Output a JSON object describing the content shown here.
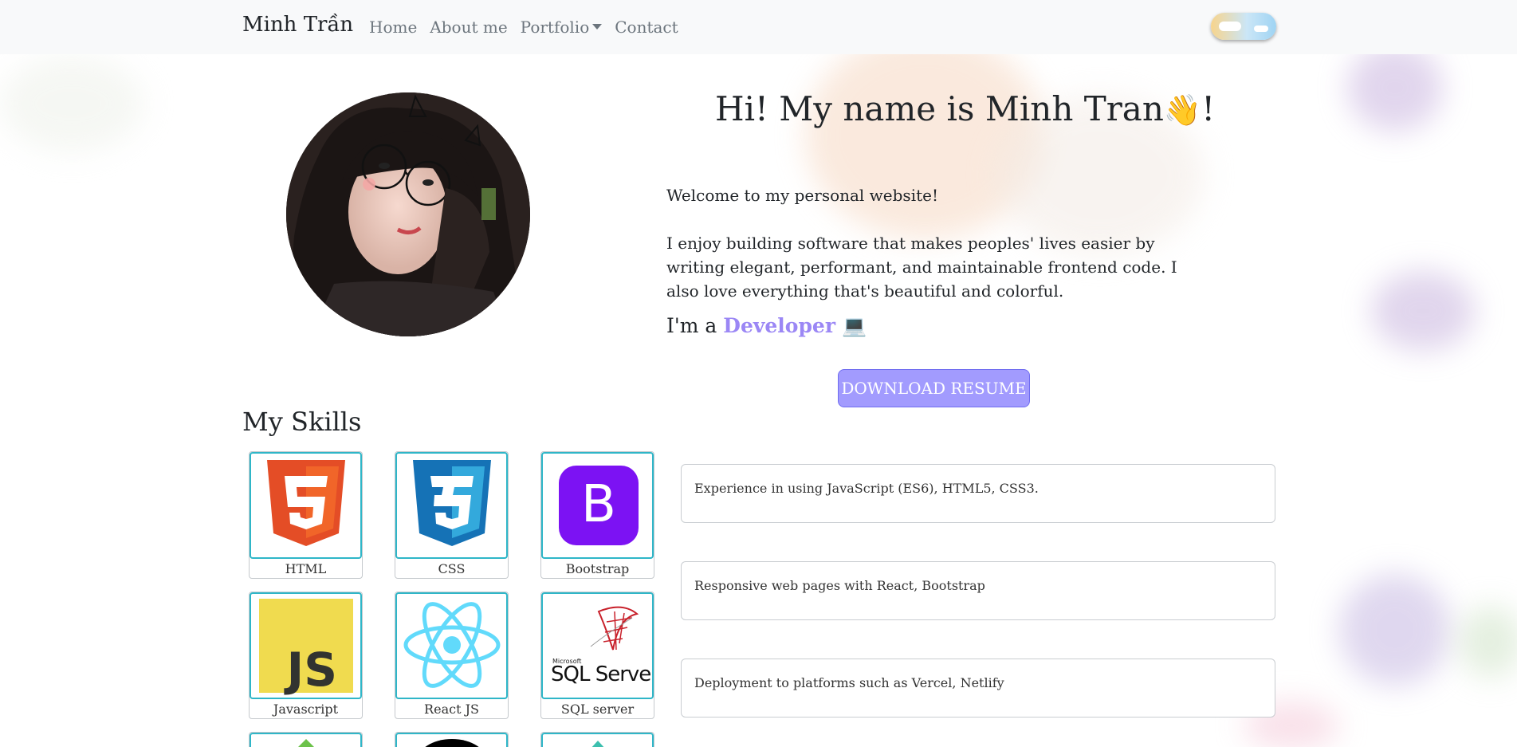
{
  "nav": {
    "brand": "Minh Trần",
    "links": [
      "Home",
      "About me",
      "Portfolio",
      "Contact"
    ]
  },
  "hero": {
    "title": "Hi! My name is Minh Tran",
    "title_suffix": "!",
    "wave_emoji": "👋",
    "welcome": "Welcome to my personal website!",
    "bio": "I enjoy building software that makes peoples' lives easier by writing elegant, performant, and maintainable frontend code. I also love everything that's beautiful and colorful.",
    "role_prefix": "I'm a",
    "role_highlight": "Developer",
    "role_emoji": "💻",
    "resume_button": "DOWNLOAD RESUME"
  },
  "skills": {
    "title": "My Skills",
    "items": [
      {
        "label": "HTML",
        "icon": "html5-icon"
      },
      {
        "label": "CSS",
        "icon": "css3-icon"
      },
      {
        "label": "Bootstrap",
        "icon": "bootstrap-icon"
      },
      {
        "label": "Javascript",
        "icon": "javascript-icon"
      },
      {
        "label": "React JS",
        "icon": "react-icon"
      },
      {
        "label": "SQL server",
        "icon": "sql-server-icon"
      }
    ],
    "sql_logo_small": "Microsoft",
    "sql_logo_text": "SQL Server",
    "experience": [
      "Experience in using JavaScript (ES6), HTML5, CSS3.",
      "Responsive web pages with React, Bootstrap",
      "Deployment to platforms such as Vercel, Netlify"
    ]
  },
  "colors": {
    "accent": "#9b87f5",
    "button": "#a29bfe",
    "card_border": "#2fb6c8"
  }
}
